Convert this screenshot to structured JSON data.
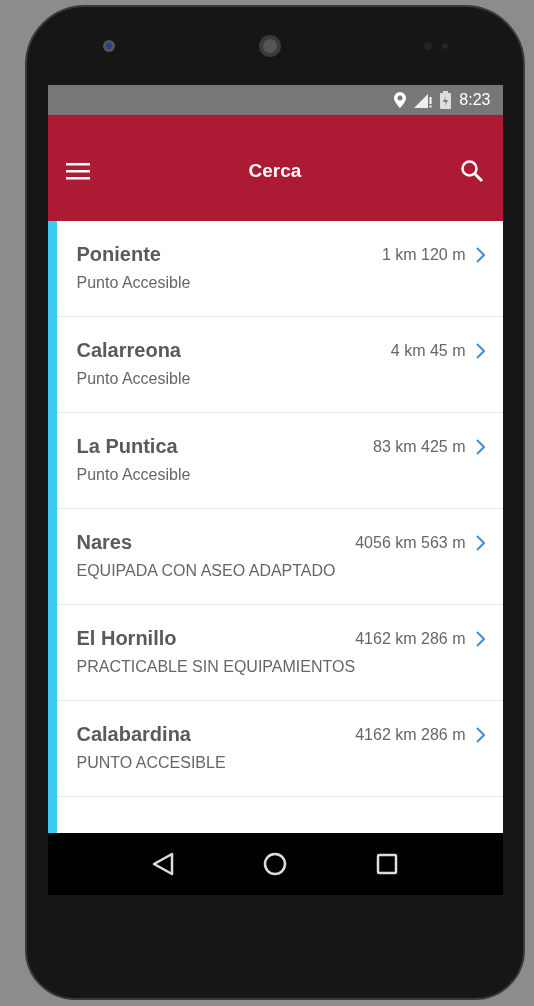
{
  "status_bar": {
    "time": "8:23"
  },
  "app_bar": {
    "title": "Cerca"
  },
  "places": [
    {
      "name": "Poniente",
      "distance": "1 km 120 m",
      "category": "Punto Accesible"
    },
    {
      "name": "Calarreona",
      "distance": "4 km 45 m",
      "category": "Punto Accesible"
    },
    {
      "name": "La Puntica",
      "distance": "83 km 425 m",
      "category": "Punto Accesible"
    },
    {
      "name": "Nares",
      "distance": "4056 km 563 m",
      "category": "EQUIPADA CON ASEO ADAPTADO"
    },
    {
      "name": "El Hornillo",
      "distance": "4162 km 286 m",
      "category": "PRACTICABLE SIN EQUIPAMIENTOS"
    },
    {
      "name": "Calabardina",
      "distance": "4162 km 286 m",
      "category": "PUNTO ACCESIBLE"
    }
  ]
}
